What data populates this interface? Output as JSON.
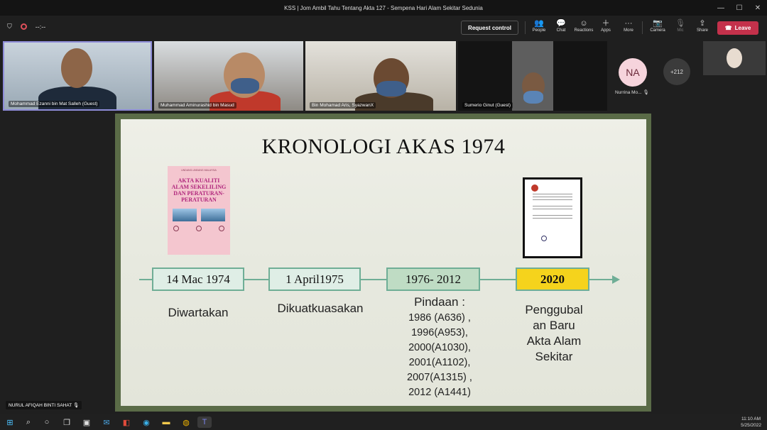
{
  "window": {
    "title": "KSS | Jom Ambil Tahu Tentang Akta 127 - Sempena Hari Alam Sekitar Sedunia"
  },
  "meeting": {
    "timer": "--:--",
    "request_control_label": "Request control",
    "toolbar": [
      {
        "label": "People",
        "icon": "people-icon",
        "glyph": "👥"
      },
      {
        "label": "Chat",
        "icon": "chat-icon",
        "glyph": "💬"
      },
      {
        "label": "Reactions",
        "icon": "reactions-icon",
        "glyph": "☺"
      },
      {
        "label": "Apps",
        "icon": "apps-icon",
        "glyph": "＋"
      },
      {
        "label": "More",
        "icon": "more-icon",
        "glyph": "···"
      },
      {
        "label": "Camera",
        "icon": "camera-icon",
        "glyph": "📷"
      },
      {
        "label": "Mic",
        "icon": "mic-off-icon",
        "glyph": "🎙"
      },
      {
        "label": "Share",
        "icon": "share-icon",
        "glyph": "⇪"
      }
    ],
    "leave_label": "Leave",
    "accent": "#c4314b"
  },
  "participants": {
    "tiles": [
      {
        "name": "Mohammad Ezanni bin Mat Salleh (Guest)"
      },
      {
        "name": "Muhammad Aminurashid bin Masud"
      },
      {
        "name": "Bin Mohamad Aris, SyazwanX"
      },
      {
        "name": "Sumerio Ginut (Guest)"
      }
    ],
    "na_initials": "NA",
    "na_name": "Nurrina Mo...",
    "overflow_count": "+212",
    "self_name": "NURUL AFIQAH BINTI SAHAT"
  },
  "slide": {
    "title": "KRONOLOGI  AKAS 1974",
    "book": {
      "header": "UNDANG-UNDANG MALAYSIA",
      "title": "AKTA KUALITI ALAM SEKELILING DAN PERATURAN-PERATURAN"
    },
    "timeline": [
      {
        "date": "14 Mac 1974",
        "label": "Diwartakan",
        "highlight": false
      },
      {
        "date": "1 April1975",
        "label": "Dikuatkuasakan",
        "highlight": false
      },
      {
        "date": "1976- 2012",
        "label": "Pindaan :",
        "highlight": false,
        "amendments": [
          "1986 (A636) ,",
          "1996(A953),",
          "2000(A1030),",
          "2001(A1102),",
          "2007(A1315) ,",
          "2012 (A1441)"
        ]
      },
      {
        "date": "2020",
        "label_lines": [
          "Penggubal",
          "an Baru",
          "Akta Alam",
          "Sekitar"
        ],
        "highlight": true
      }
    ],
    "colors": {
      "box_normal": "#dfeee6",
      "box_highlight": "#f5d31c",
      "line": "#6fae96"
    }
  },
  "taskbar": {
    "time": "11:10 AM",
    "date": "5/25/2022"
  }
}
